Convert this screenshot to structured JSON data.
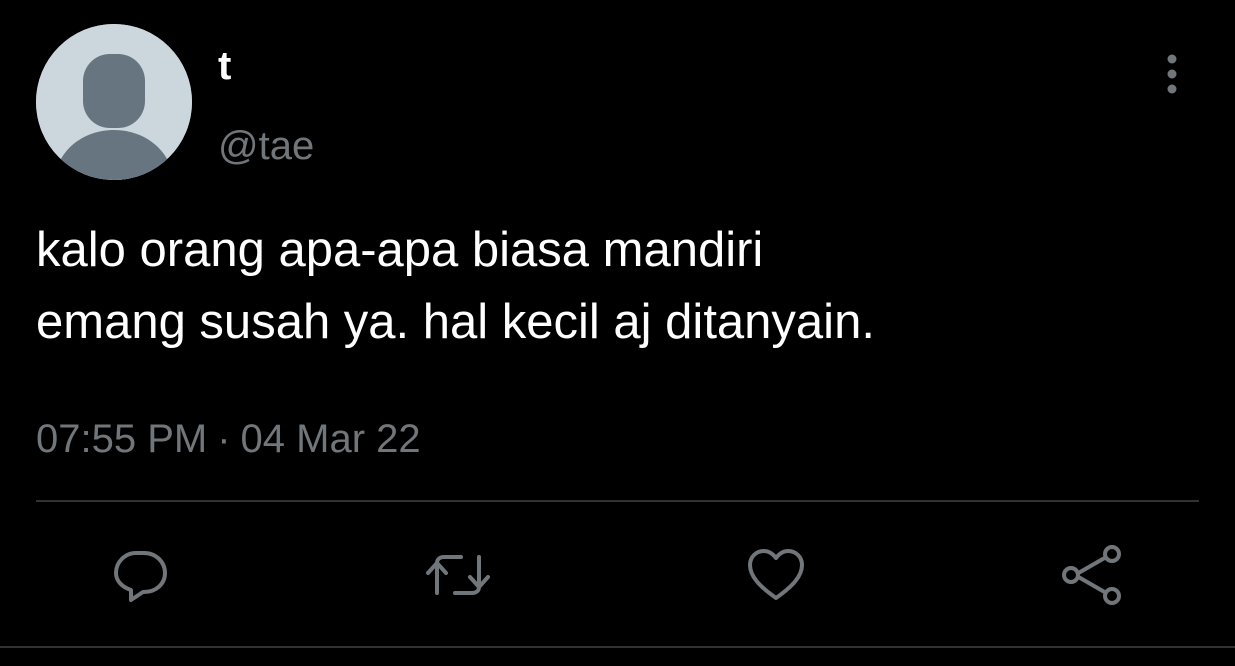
{
  "tweet": {
    "author": {
      "display_name": "t",
      "handle": "@tae",
      "avatar_icon": "default-avatar-icon"
    },
    "text": "kalo orang apa-apa biasa mandiri\nemang susah ya. hal kecil aj ditanyain.",
    "time": "07:55 PM",
    "separator": "·",
    "date": "04 Mar 22"
  },
  "actions": [
    {
      "name": "reply",
      "icon": "reply-icon"
    },
    {
      "name": "retweet",
      "icon": "retweet-icon"
    },
    {
      "name": "like",
      "icon": "heart-icon"
    },
    {
      "name": "share",
      "icon": "share-icon"
    }
  ],
  "menu": {
    "icon": "more-options-icon"
  },
  "colors": {
    "background": "#000000",
    "text_primary": "#ffffff",
    "text_secondary": "#71767b",
    "divider": "#2f3336",
    "avatar_bg": "#ccd6dd",
    "avatar_figure": "#66757f"
  }
}
